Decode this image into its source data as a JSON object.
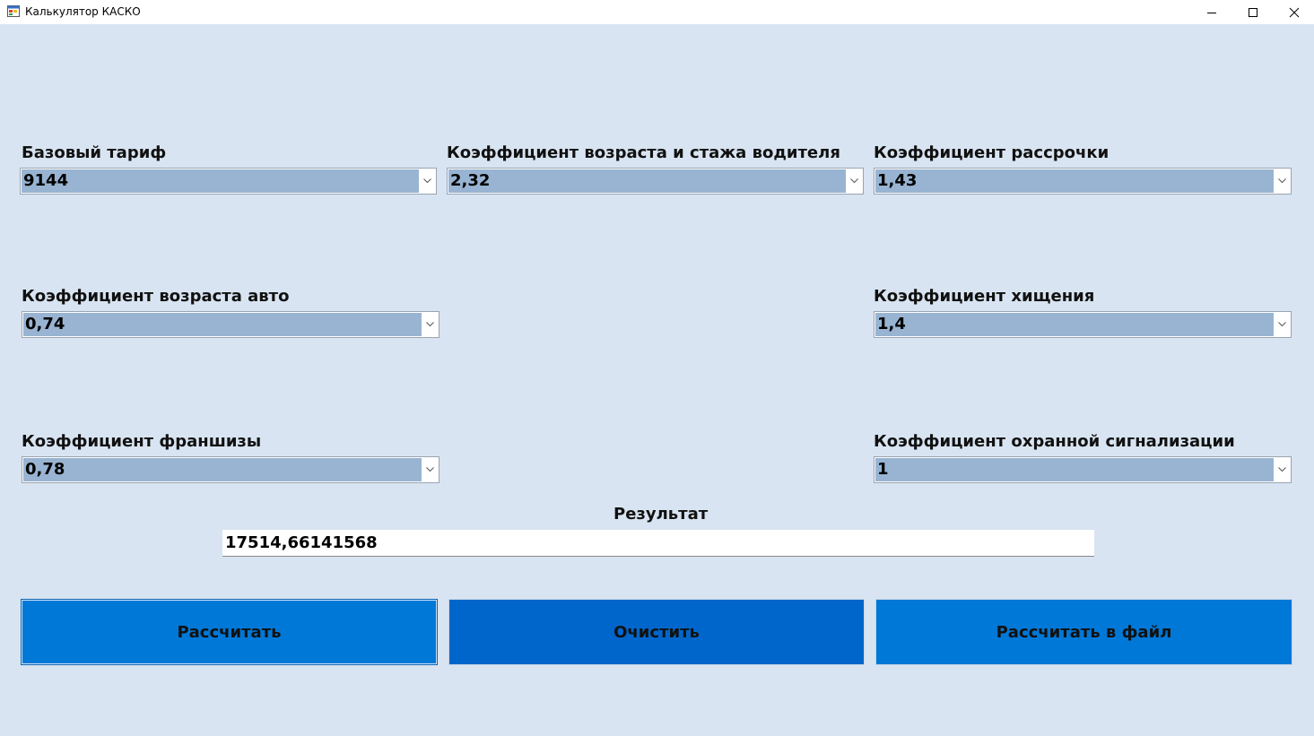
{
  "window": {
    "title": "Калькулятор КАСКО"
  },
  "fields": {
    "base_tariff": {
      "label": "Базовый тариф",
      "value": "9144"
    },
    "driver_age": {
      "label": "Коэффициент возраста и стажа водителя",
      "value": "2,32"
    },
    "installment": {
      "label": "Коэффициент рассрочки",
      "value": "1,43"
    },
    "car_age": {
      "label": "Коэффициент возраста авто",
      "value": "0,74"
    },
    "theft": {
      "label": "Коэффициент хищения",
      "value": "1,4"
    },
    "franchise": {
      "label": "Коэффициент франшизы",
      "value": "0,78"
    },
    "alarm": {
      "label": "Коэффициент охранной сигнализации",
      "value": "1"
    }
  },
  "result": {
    "label": "Результат",
    "value": "17514,66141568"
  },
  "buttons": {
    "calculate": "Рассчитать",
    "clear": "Очистить",
    "calculate_to_file": "Рассчитать в файл"
  },
  "icons": {
    "app": "app-window-icon",
    "minimize": "minimize-icon",
    "maximize": "maximize-icon",
    "close": "close-icon",
    "dropdown": "chevron-down-icon"
  },
  "colors": {
    "background": "#d8e4f1",
    "combo_selection": "#98b4d2",
    "button_primary": "#0078d7",
    "button_clear": "#0066cc"
  }
}
